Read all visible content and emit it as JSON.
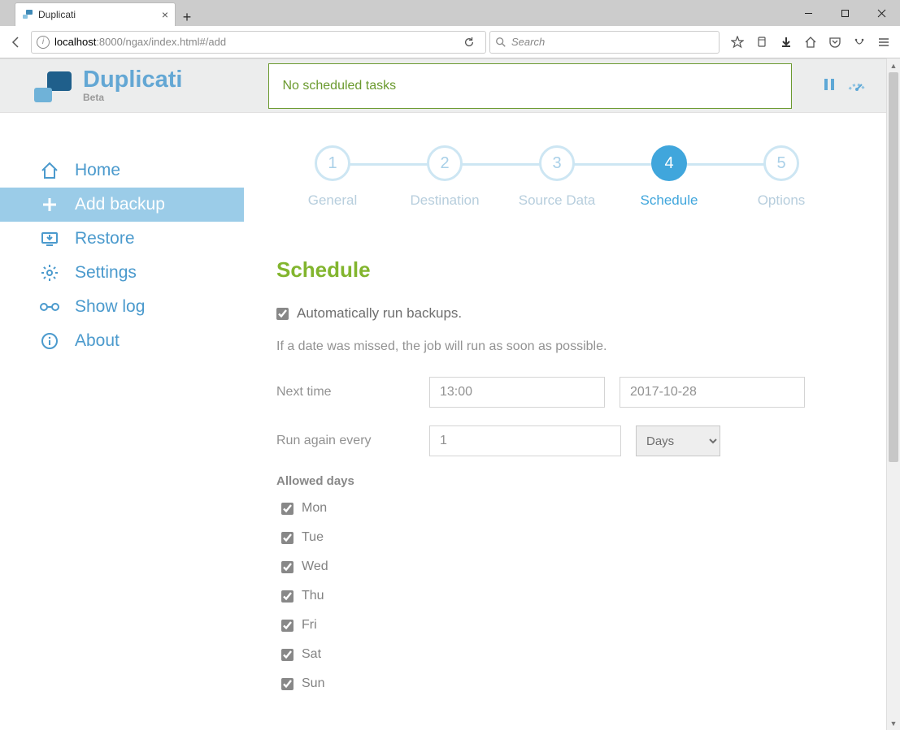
{
  "browser": {
    "tab_title": "Duplicati",
    "url_host": "localhost",
    "url_port": ":8000",
    "url_path": "/ngax/index.html#/add",
    "search_placeholder": "Search"
  },
  "app": {
    "name": "Duplicati",
    "beta_label": "Beta",
    "status_message": "No scheduled tasks"
  },
  "sidebar": {
    "items": [
      {
        "label": "Home"
      },
      {
        "label": "Add backup"
      },
      {
        "label": "Restore"
      },
      {
        "label": "Settings"
      },
      {
        "label": "Show log"
      },
      {
        "label": "About"
      }
    ]
  },
  "steps": [
    {
      "num": "1",
      "label": "General"
    },
    {
      "num": "2",
      "label": "Destination"
    },
    {
      "num": "3",
      "label": "Source Data"
    },
    {
      "num": "4",
      "label": "Schedule"
    },
    {
      "num": "5",
      "label": "Options"
    }
  ],
  "schedule": {
    "title": "Schedule",
    "auto_label": "Automatically run backups.",
    "hint": "If a date was missed, the job will run as soon as possible.",
    "next_time_label": "Next time",
    "next_time_value": "13:00",
    "next_date_value": "2017-10-28",
    "run_again_label": "Run again every",
    "run_again_value": "1",
    "run_again_unit": "Days",
    "allowed_days_label": "Allowed days",
    "days": [
      "Mon",
      "Tue",
      "Wed",
      "Thu",
      "Fri",
      "Sat",
      "Sun"
    ]
  }
}
